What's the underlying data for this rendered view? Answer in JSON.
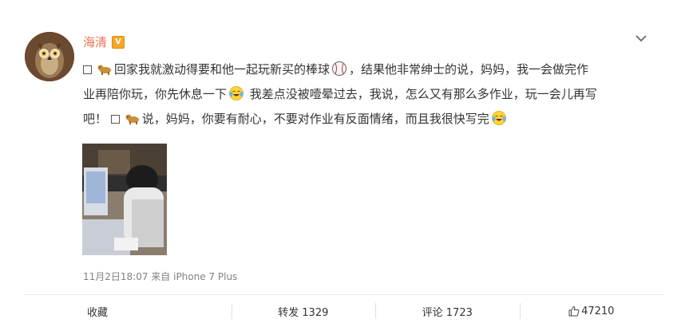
{
  "post": {
    "author": "海清",
    "verified_badge": "V",
    "text": {
      "line1_a": "回家我就激动得要和他一起玩新买的棒球",
      "line1_b": "，结果他非常绅士的说，妈妈，我一会做完作",
      "line2_a": "业再陪你玩，你先休息一下",
      "line2_b": " 我差点没被噎晕过去，我说，怎么又有那么多作业，玩一会儿再写",
      "line3_a": "吧！",
      "line3_b": "说，妈妈，你要有耐心，不要对作业有反面情绪，而且我很快写完"
    },
    "meta": "11月2日18:07 来自 iPhone 7 Plus"
  },
  "icons": {
    "more": "chevron-down-icon",
    "baseball": "baseball-emoji-icon",
    "laugh": "laugh-cry-emoji-icon",
    "dog": "dog-emoji-icon",
    "like": "thumbs-up-icon"
  },
  "actions": {
    "favorite": "收藏",
    "repost": "转发 1329",
    "comment": "评论 1723",
    "like": "47210"
  },
  "colors": {
    "username": "#eb7350",
    "badge": "#f6a623",
    "meta": "#808080",
    "text": "#333333"
  }
}
